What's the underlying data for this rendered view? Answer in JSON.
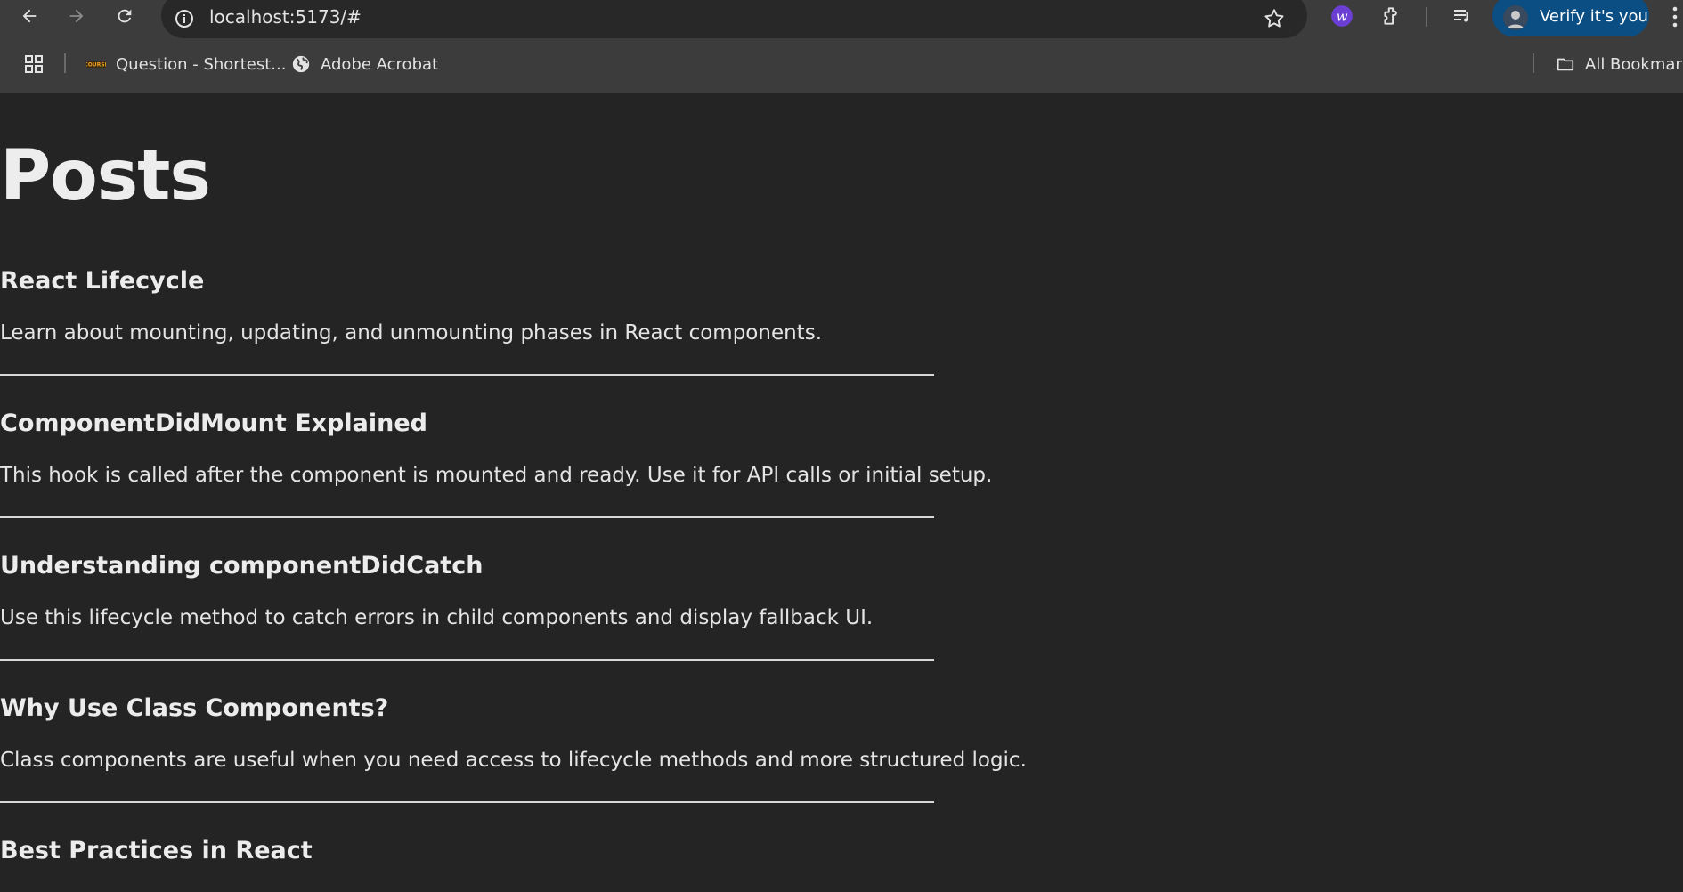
{
  "browser": {
    "url": "localhost:5173/#",
    "verify_label": "Verify it's you",
    "bookmarks": [
      {
        "label": "Question - Shortest...",
        "icon": "coursera-icon"
      },
      {
        "label": "Adobe Acrobat",
        "icon": "globe-icon"
      }
    ],
    "all_bookmarks_label": "All Bookmarks"
  },
  "page": {
    "title": "Posts",
    "posts": [
      {
        "title": "React Lifecycle",
        "body": "Learn about mounting, updating, and unmounting phases in React components."
      },
      {
        "title": "ComponentDidMount Explained",
        "body": "This hook is called after the component is mounted and ready. Use it for API calls or initial setup."
      },
      {
        "title": "Understanding componentDidCatch",
        "body": "Use this lifecycle method to catch errors in child components and display fallback UI."
      },
      {
        "title": "Why Use Class Components?",
        "body": "Class components are useful when you need access to lifecycle methods and more structured logic."
      },
      {
        "title": "Best Practices in React",
        "body": ""
      }
    ]
  },
  "colors": {
    "page_background": "#242424",
    "chrome_background": "#3c3c3c",
    "verify_button": "#0b4e84"
  }
}
